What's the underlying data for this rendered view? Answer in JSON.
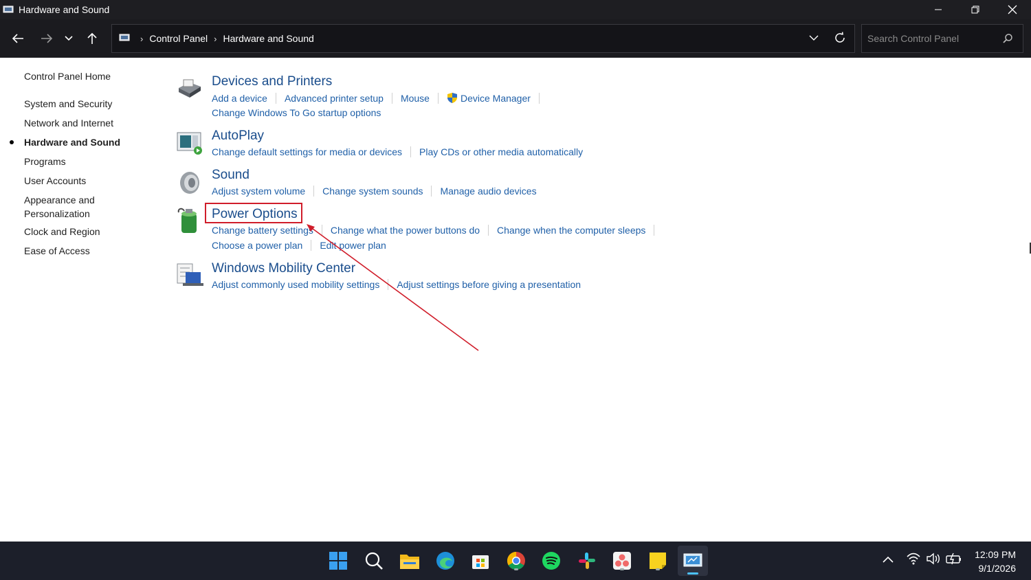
{
  "window": {
    "title": "Hardware and Sound"
  },
  "address": {
    "crumbs": [
      "Control Panel",
      "Hardware and Sound"
    ],
    "search_placeholder": "Search Control Panel"
  },
  "sidebar": {
    "home": "Control Panel Home",
    "items": [
      {
        "label": "System and Security",
        "active": false
      },
      {
        "label": "Network and Internet",
        "active": false
      },
      {
        "label": "Hardware and Sound",
        "active": true
      },
      {
        "label": "Programs",
        "active": false
      },
      {
        "label": "User Accounts",
        "active": false
      },
      {
        "label": "Appearance and Personalization",
        "line1": "Appearance and",
        "line2": "Personalization",
        "active": false
      },
      {
        "label": "Clock and Region",
        "active": false
      },
      {
        "label": "Ease of Access",
        "active": false
      }
    ]
  },
  "sections": [
    {
      "title": "Devices and Printers",
      "icon": "printer-icon",
      "links_row1": [
        "Add a device",
        "Advanced printer setup",
        "Mouse",
        "Device Manager"
      ],
      "links_row2": [
        "Change Windows To Go startup options"
      ]
    },
    {
      "title": "AutoPlay",
      "icon": "autoplay-icon",
      "links_row1": [
        "Change default settings for media or devices",
        "Play CDs or other media automatically"
      ]
    },
    {
      "title": "Sound",
      "icon": "speaker-icon",
      "links_row1": [
        "Adjust system volume",
        "Change system sounds",
        "Manage audio devices"
      ]
    },
    {
      "title": "Power Options",
      "icon": "battery-icon",
      "links_row1": [
        "Change battery settings",
        "Change what the power buttons do",
        "Change when the computer sleeps"
      ],
      "links_row2": [
        "Choose a power plan",
        "Edit power plan"
      ]
    },
    {
      "title": "Windows Mobility Center",
      "icon": "mobility-center-icon",
      "links_row1": [
        "Adjust commonly used mobility settings",
        "Adjust settings before giving a presentation"
      ]
    }
  ],
  "annotation": {
    "color": "#d01d2a"
  },
  "taskbar": {
    "apps": [
      "start-icon",
      "search-icon",
      "file-explorer-icon",
      "edge-icon",
      "store-icon",
      "chrome-icon",
      "spotify-icon",
      "slack-icon",
      "asana-icon",
      "sticky-notes-icon",
      "control-panel-icon"
    ],
    "time": "12:09 PM",
    "date": "9/1/2026"
  },
  "colors": {
    "link": "#2060a8",
    "heading": "#1a4d8c",
    "titlebar": "#1e1e22",
    "taskbar": "#1c1f2a"
  }
}
